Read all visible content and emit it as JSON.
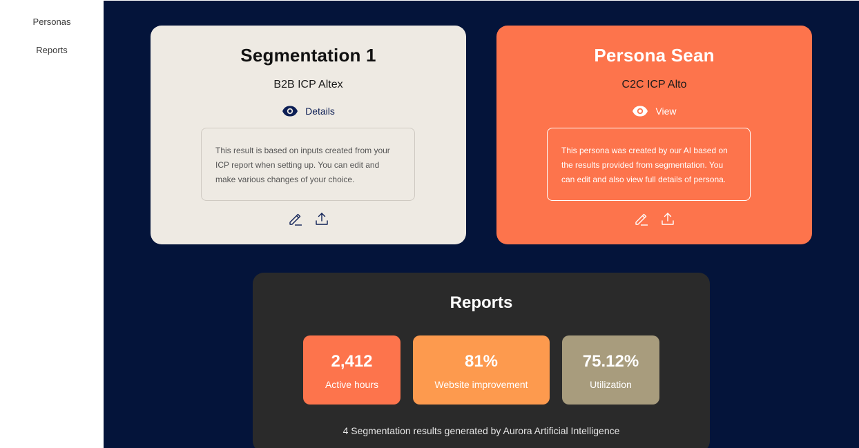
{
  "sidebar": {
    "items": [
      {
        "label": "Personas"
      },
      {
        "label": "Reports"
      }
    ]
  },
  "cards": [
    {
      "title": "Segmentation 1",
      "subtitle": "B2B ICP Altex",
      "link_label": "Details",
      "link_icon": "eye-icon",
      "description": "This result is based on inputs created from your ICP report when setting up. You can edit and make various changes of your choice.",
      "actions": [
        "pencil-icon",
        "upload-icon"
      ],
      "background": "#eeeae3"
    },
    {
      "title": "Persona Sean",
      "subtitle": "C2C ICP Alto",
      "link_label": "View",
      "link_icon": "eye-icon",
      "description": "This persona was created by our AI based on the results provided from segmentation. You can edit and also view full details of persona.",
      "actions": [
        "pencil-icon",
        "upload-icon"
      ],
      "background": "#fd744c"
    }
  ],
  "reports": {
    "title": "Reports",
    "stats": [
      {
        "value": "2,412",
        "label": "Active hours",
        "color": "#fd744c"
      },
      {
        "value": "81%",
        "label": "Website improvement",
        "color": "#fd9a4e"
      },
      {
        "value": "75.12%",
        "label": "Utilization",
        "color": "#a89c7d"
      }
    ],
    "footer": "4 Segmentation results generated by Aurora Artificial Intelligence"
  },
  "colors": {
    "main_background": "#04143a",
    "reports_background": "#2a2a2a",
    "accent_navy": "#0d1f55"
  }
}
